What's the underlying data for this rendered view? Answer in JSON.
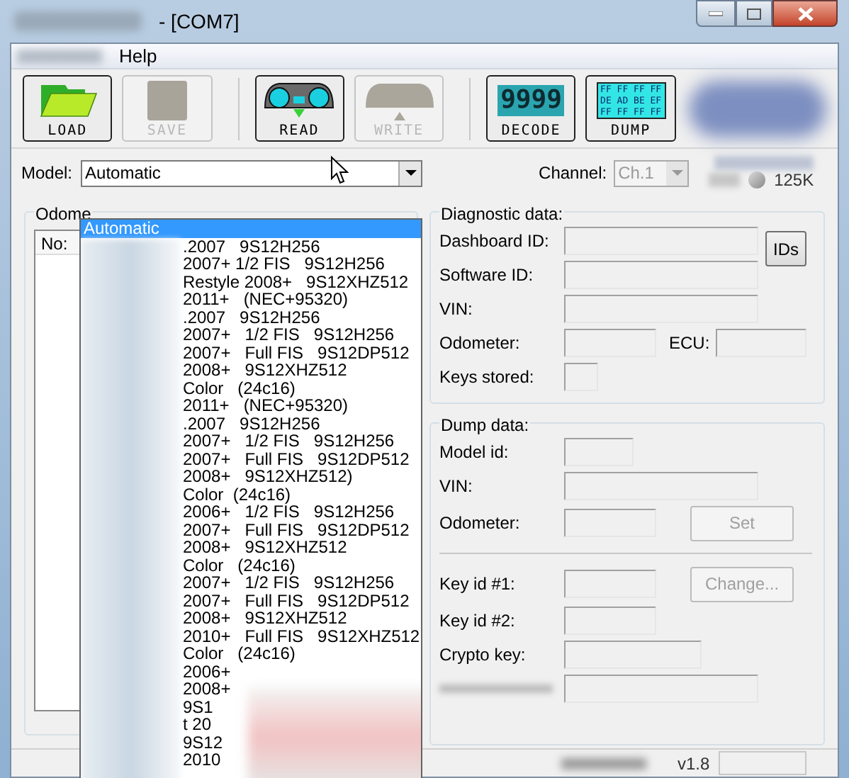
{
  "window": {
    "title": "- [COM7]"
  },
  "menu": [
    "Help"
  ],
  "toolbar": [
    {
      "kind": "load",
      "label": "LOAD",
      "disabled": false
    },
    {
      "kind": "save",
      "label": "SAVE",
      "disabled": true
    },
    {
      "kind": "read",
      "label": "READ",
      "disabled": false
    },
    {
      "kind": "write",
      "label": "WRITE",
      "disabled": true
    },
    {
      "kind": "decode",
      "label": "DECODE",
      "disabled": false,
      "digits": "9999"
    },
    {
      "kind": "dump",
      "label": "DUMP",
      "disabled": false,
      "hex": [
        "FF FF FF FF",
        "DE AD BE EF",
        "FF FF FF FF"
      ]
    }
  ],
  "model": {
    "label": "Model:",
    "value": "Automatic"
  },
  "channel": {
    "label": "Channel:",
    "value": "Ch.1",
    "disabled": true
  },
  "speed": {
    "reading": "125K"
  },
  "dropdown": {
    "items": [
      {
        "text": "Automatic",
        "selected": true
      },
      {
        "text": ".2007   9S12H256",
        "selected": false
      },
      {
        "text": "2007+ 1/2 FIS   9S12H256",
        "selected": false
      },
      {
        "text": "Restyle 2008+   9S12XHZ512",
        "selected": false
      },
      {
        "text": "2011+   (NEC+95320)",
        "selected": false
      },
      {
        "text": ".2007   9S12H256",
        "selected": false
      },
      {
        "text": "2007+   1/2 FIS   9S12H256",
        "selected": false
      },
      {
        "text": "2007+   Full FIS   9S12DP512",
        "selected": false
      },
      {
        "text": "2008+   9S12XHZ512",
        "selected": false
      },
      {
        "text": "Color   (24c16)",
        "selected": false
      },
      {
        "text": "2011+   (NEC+95320)",
        "selected": false
      },
      {
        "text": ".2007   9S12H256",
        "selected": false
      },
      {
        "text": "2007+   1/2 FIS   9S12H256",
        "selected": false
      },
      {
        "text": "2007+   Full FIS   9S12DP512",
        "selected": false
      },
      {
        "text": "2008+   9S12XHZ512)",
        "selected": false
      },
      {
        "text": "Color  (24c16)",
        "selected": false
      },
      {
        "text": "2006+   1/2 FIS   9S12H256",
        "selected": false
      },
      {
        "text": "2007+   Full FIS   9S12DP512",
        "selected": false
      },
      {
        "text": "2008+   9S12XHZ512",
        "selected": false
      },
      {
        "text": "Color   (24c16)",
        "selected": false
      },
      {
        "text": "2007+   1/2 FIS   9S12H256",
        "selected": false
      },
      {
        "text": "2007+   Full FIS   9S12DP512",
        "selected": false
      },
      {
        "text": "2008+   9S12XHZ512",
        "selected": false
      },
      {
        "text": "2010+   Full FIS   9S12XHZ512",
        "selected": false
      },
      {
        "text": "Color   (24c16)",
        "selected": false
      },
      {
        "text": "2006+",
        "selected": false
      },
      {
        "text": "2008+",
        "selected": false
      },
      {
        "text": "9S1",
        "selected": false
      },
      {
        "text": "t 20",
        "selected": false
      },
      {
        "text": "9S12",
        "selected": false
      },
      {
        "text": "2010",
        "selected": false
      }
    ]
  },
  "odometer_group": {
    "title": "Odome",
    "columns": [
      "No:"
    ]
  },
  "diagnostic": {
    "title": "Diagnostic data:",
    "ids_button": "IDs",
    "fields": [
      {
        "kind": "long",
        "label": "Dashboard ID:"
      },
      {
        "kind": "long",
        "label": "Software ID:"
      },
      {
        "kind": "long",
        "label": "VIN:"
      },
      {
        "kind": "pair",
        "label": "Odometer:",
        "label_2": "ECU:"
      },
      {
        "kind": "tiny",
        "label": "Keys stored:"
      }
    ]
  },
  "dump": {
    "title": "Dump data:",
    "fields": [
      {
        "kind": "small",
        "label": "Model id:"
      },
      {
        "kind": "long",
        "label": "VIN:"
      },
      {
        "kind": "medium",
        "label": "Odometer:",
        "button": {
          "label": "Set",
          "disabled": true
        }
      },
      {
        "kind": "divider"
      },
      {
        "kind": "medium",
        "label": "Key id #1:",
        "button": {
          "label": "Change...",
          "disabled": true
        }
      },
      {
        "kind": "medium",
        "label": "Key id #2:"
      },
      {
        "kind": "wide",
        "label": "Crypto key:"
      },
      {
        "kind": "long"
      }
    ]
  },
  "status_bar": {
    "version": "v1.8"
  }
}
